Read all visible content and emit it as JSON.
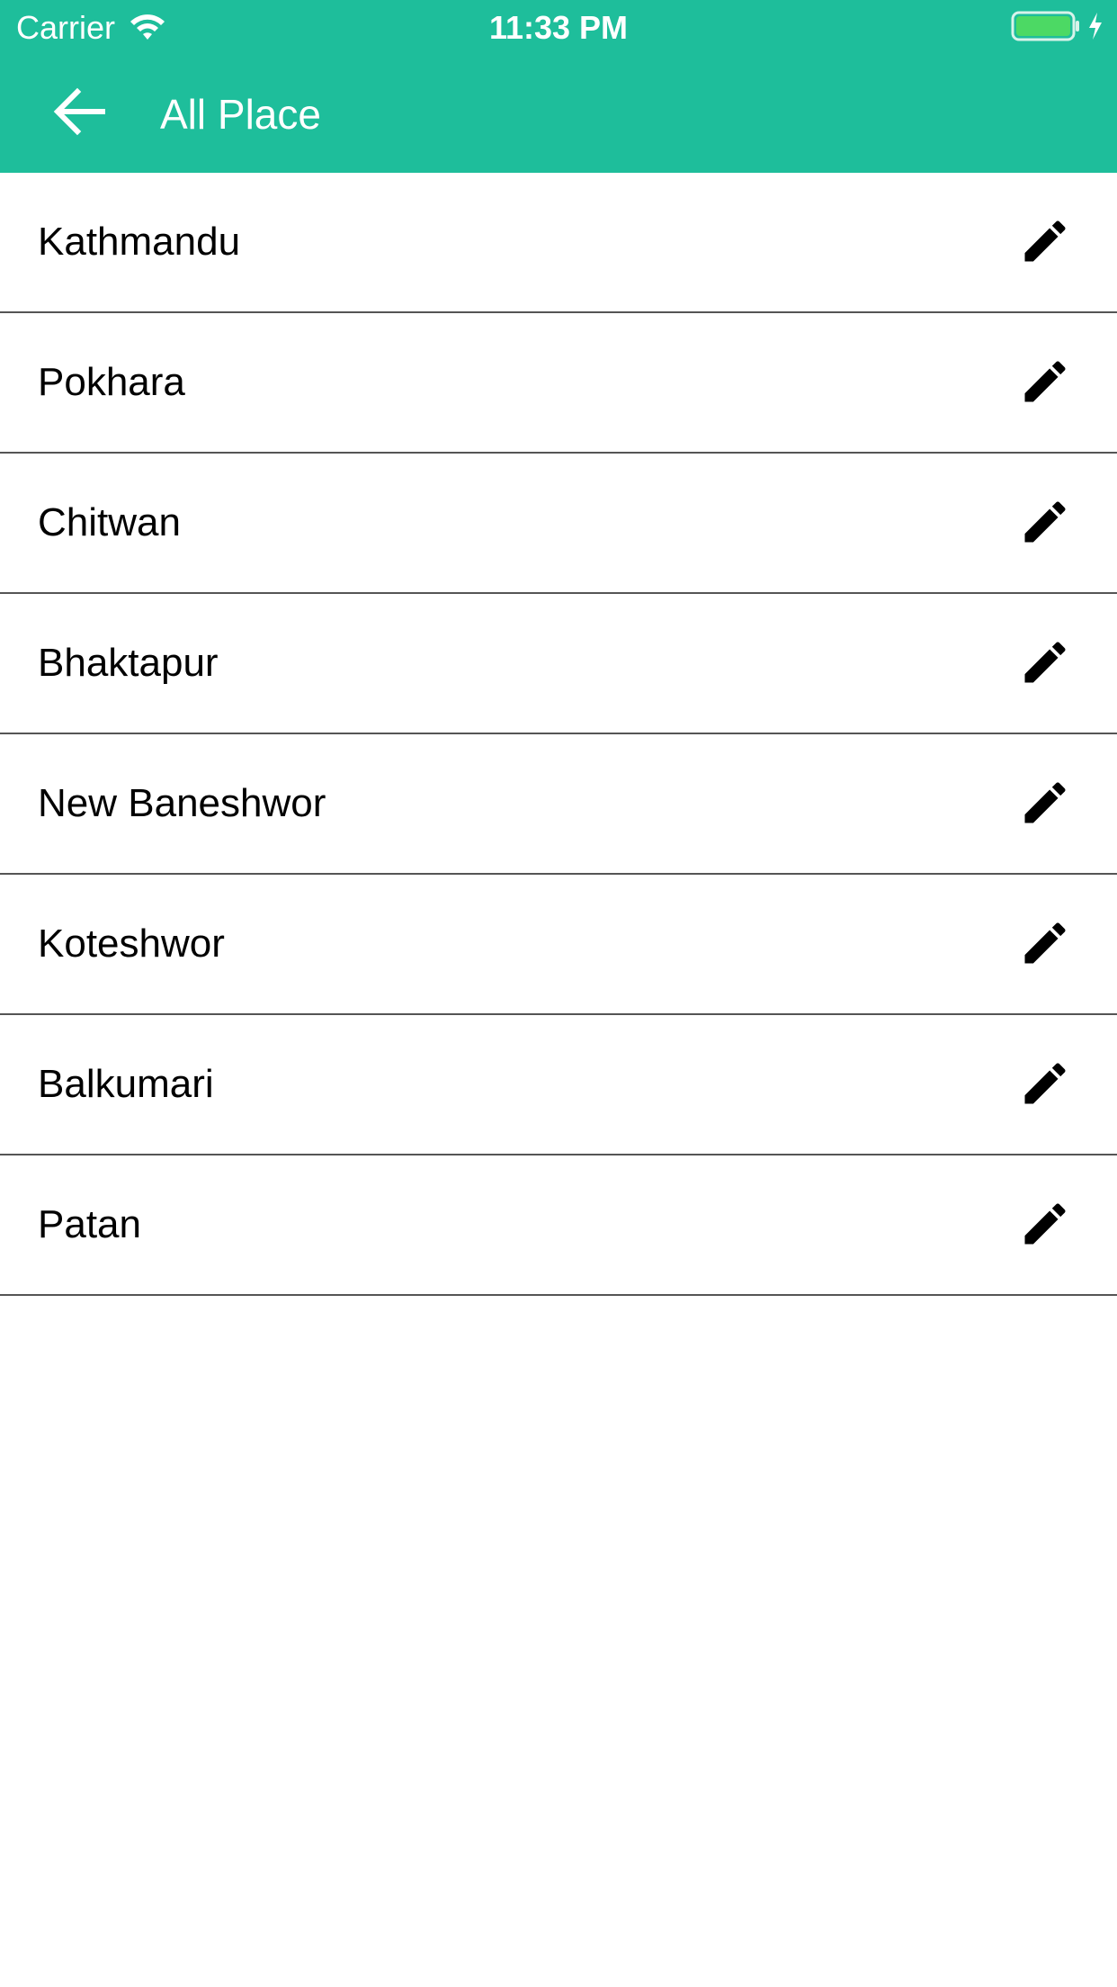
{
  "status_bar": {
    "carrier": "Carrier",
    "time": "11:33 PM",
    "icons": [
      "wifi-icon",
      "battery-icon",
      "charging-bolt-icon"
    ],
    "battery_color": "#4cd964"
  },
  "app_bar": {
    "title": "All Place",
    "back_icon": "arrow-back-icon",
    "color": "#1ebe9b"
  },
  "places": [
    {
      "name": "Kathmandu",
      "action_icon": "edit-pencil-icon"
    },
    {
      "name": "Pokhara",
      "action_icon": "edit-pencil-icon"
    },
    {
      "name": "Chitwan",
      "action_icon": "edit-pencil-icon"
    },
    {
      "name": "Bhaktapur",
      "action_icon": "edit-pencil-icon"
    },
    {
      "name": "New Baneshwor",
      "action_icon": "edit-pencil-icon"
    },
    {
      "name": "Koteshwor",
      "action_icon": "edit-pencil-icon"
    },
    {
      "name": "Balkumari",
      "action_icon": "edit-pencil-icon"
    },
    {
      "name": "Patan",
      "action_icon": "edit-pencil-icon"
    }
  ]
}
